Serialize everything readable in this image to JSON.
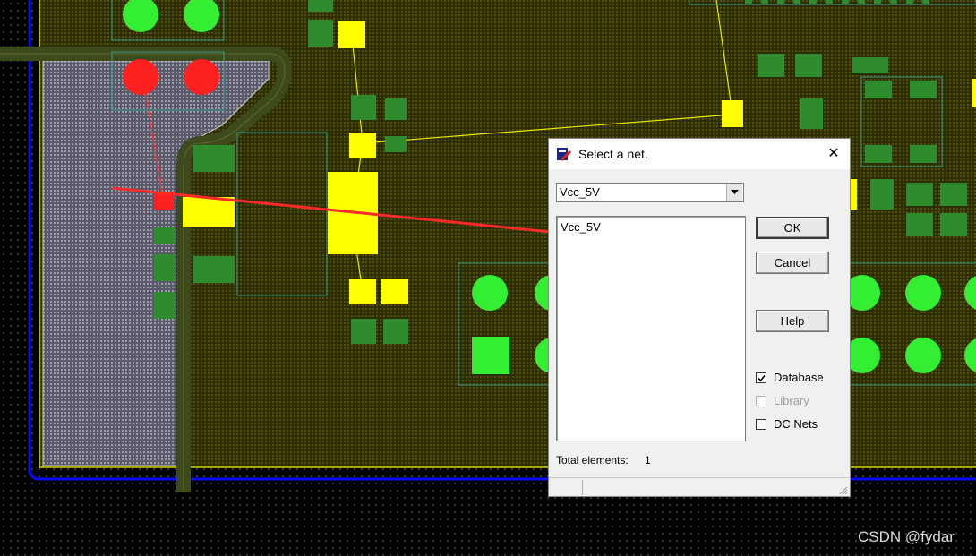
{
  "dialog": {
    "title": "Select a net.",
    "close_glyph": "✕",
    "combo_value": "Vcc_5V",
    "list_items": [
      "Vcc_5V"
    ],
    "buttons": {
      "ok": "OK",
      "cancel": "Cancel",
      "help": "Help"
    },
    "checkboxes": [
      {
        "label": "Database",
        "checked": true,
        "enabled": true
      },
      {
        "label": "Library",
        "checked": false,
        "enabled": false
      },
      {
        "label": "DC Nets",
        "checked": false,
        "enabled": true
      }
    ],
    "total_label": "Total elements:",
    "total_value": "1"
  },
  "watermark": "CSDN @fydar",
  "colors": {
    "board": "#3b3b06",
    "copper_pad": "#ffff00",
    "smd_pad": "#2e8b2e",
    "through_hole": "#33ee33",
    "selected": "#ff2020",
    "trace": "#3c4a1c",
    "outline": "#0a0aff",
    "annotation_arrow": "#ff2a2a"
  }
}
